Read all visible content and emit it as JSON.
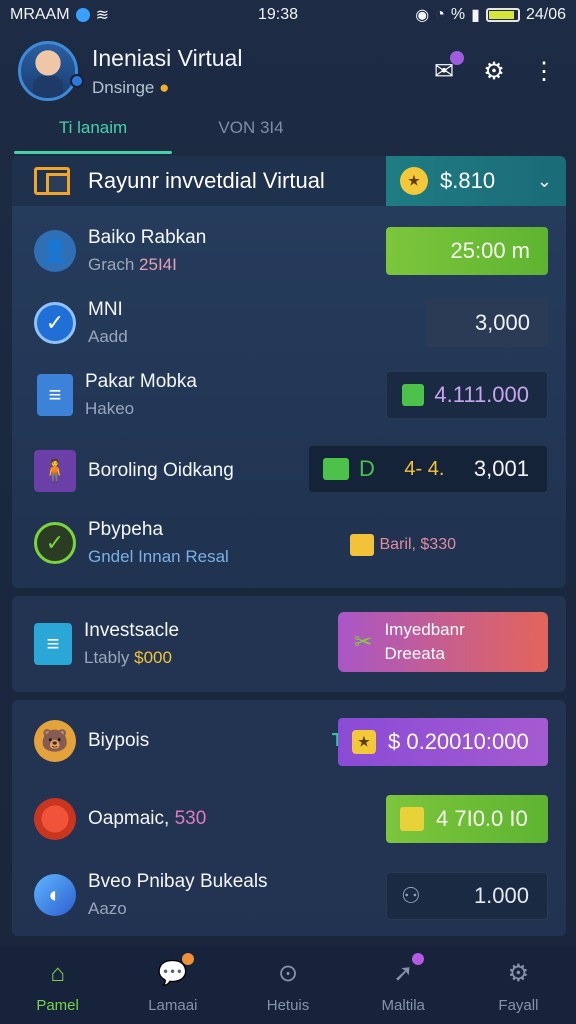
{
  "status_bar": {
    "carrier": "MRAAM",
    "time": "19:38",
    "battery_text": "24/06",
    "extra_text": "%"
  },
  "header": {
    "title": "Ineniasi Virtual",
    "subtitle": "Dnsinge",
    "icons": [
      "avatar",
      "mail-icon",
      "gear-icon",
      "more-vertical-icon"
    ]
  },
  "tabs": [
    {
      "label": "Ti lanaim",
      "active": true
    },
    {
      "label": "VON 3I4",
      "active": false
    }
  ],
  "card1": {
    "title": "Rayunr invvetdial Virtual",
    "pill_value": "$.810",
    "rows": [
      {
        "title": "Baiko Rabkan",
        "sub": "Grach",
        "sub_accent": "25I4I",
        "value": "25:00 m",
        "icon": "person-icon"
      },
      {
        "title": "MNI",
        "sub": "Aadd",
        "sub_accent": "",
        "value": "3,000",
        "icon": "check-circle-icon"
      },
      {
        "title": "Pakar Mobka",
        "sub": "Hakeo",
        "sub_accent": "",
        "value": "4.111.000",
        "icon": "document-icon"
      },
      {
        "title": "Boroling Oidkang",
        "sub": "",
        "sub_accent": "",
        "value_left": "D",
        "value_mid": "4- 4.",
        "value": "3,001",
        "icon": "person-board-icon"
      },
      {
        "title": "Pbypeha",
        "sub": "Gndel Innan Resal",
        "sub_accent": "",
        "value": "Baril, $330",
        "icon": "check-circle-icon"
      }
    ]
  },
  "card2": {
    "title": "Investsacle",
    "sub": "Ltably",
    "sub_accent": "$000",
    "button_line1": "Imyedbanr",
    "button_line2": "Dreeata"
  },
  "card3": {
    "rows": [
      {
        "title": "Biypois",
        "prefix": "TN",
        "value": "$ 0.20010:000",
        "icon": "bear-icon"
      },
      {
        "title": "Oapmaic,",
        "title_accent": "530",
        "value": "4 7I0.0 I0",
        "icon": "pie-icon"
      },
      {
        "title": "Bveo Pnibay Bukeals",
        "sub": "Aazo",
        "value": "1.000",
        "icon": "globe-icon"
      }
    ]
  },
  "bottom_nav": [
    {
      "label": "Pamel",
      "active": true,
      "icon": "home-icon"
    },
    {
      "label": "Lamaai",
      "active": false,
      "icon": "chat-icon"
    },
    {
      "label": "Hetuis",
      "active": false,
      "icon": "search-icon"
    },
    {
      "label": "Maltila",
      "active": false,
      "icon": "rocket-icon"
    },
    {
      "label": "Fayall",
      "active": false,
      "icon": "gear-icon"
    }
  ],
  "colors": {
    "accent_green": "#7bd34a",
    "tab_active": "#46d2a8",
    "background": "#1a2840"
  }
}
